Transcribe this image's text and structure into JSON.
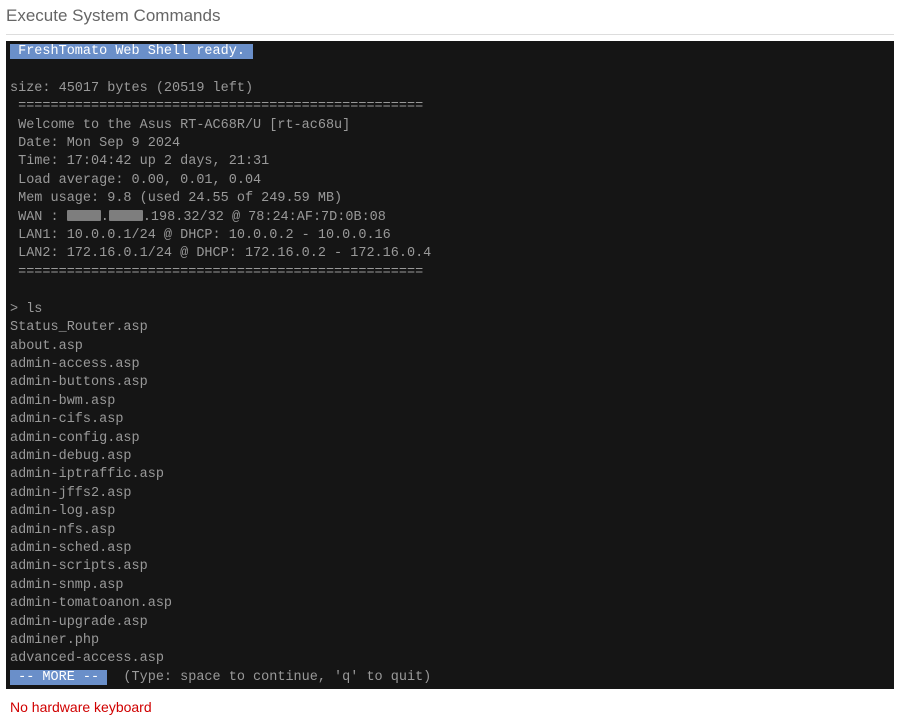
{
  "title": "Execute System Commands",
  "shell_ready": " FreshTomato Web Shell ready. ",
  "size_line": "size: 45017 bytes (20519 left)",
  "divider": " ==================================================",
  "welcome": " Welcome to the Asus RT-AC68R/U [rt-ac68u]",
  "date": " Date: Mon Sep 9 2024",
  "time": " Time: 17:04:42 up 2 days, 21:31",
  "load": " Load average: 0.00, 0.01, 0.04",
  "mem": " Mem usage: 9.8 (used 24.55 of 249.59 MB)",
  "wan_prefix": " WAN : ",
  "wan_mid": ".",
  "wan_suffix": ".198.32/32 @ 78:24:AF:7D:0B:08",
  "lan1": " LAN1: 10.0.0.1/24 @ DHCP: 10.0.0.2 - 10.0.0.16",
  "lan2": " LAN2: 172.16.0.1/24 @ DHCP: 172.16.0.2 - 172.16.0.4",
  "prompt": "> ls",
  "files": [
    "Status_Router.asp",
    "about.asp",
    "admin-access.asp",
    "admin-buttons.asp",
    "admin-bwm.asp",
    "admin-cifs.asp",
    "admin-config.asp",
    "admin-debug.asp",
    "admin-iptraffic.asp",
    "admin-jffs2.asp",
    "admin-log.asp",
    "admin-nfs.asp",
    "admin-sched.asp",
    "admin-scripts.asp",
    "admin-snmp.asp",
    "admin-tomatoanon.asp",
    "admin-upgrade.asp",
    "adminer.php",
    "advanced-access.asp"
  ],
  "more_label": " -- MORE -- ",
  "more_hint": "  (Type: space to continue, 'q' to quit)",
  "footer": "No hardware keyboard"
}
